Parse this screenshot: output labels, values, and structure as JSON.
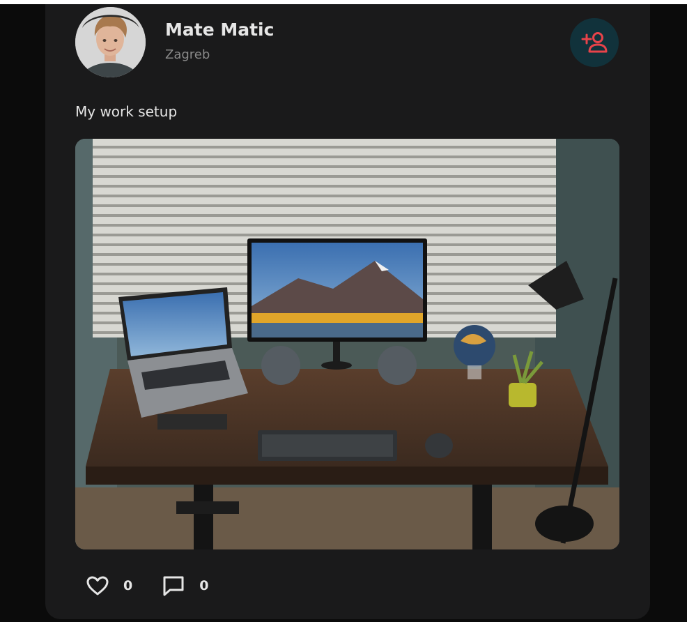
{
  "post": {
    "author": {
      "name": "Mate Matic",
      "location": "Zagreb",
      "avatar_icon": "user-avatar-photo"
    },
    "follow_icon": "add-user-icon",
    "caption": "My work setup",
    "image_icon": "desk-setup-photo",
    "likes": "0",
    "comments": "0"
  },
  "colors": {
    "card_bg": "#1a1a1b",
    "page_bg": "#0b0b0b",
    "accent": "#e8434a",
    "follow_bg": "#11323b",
    "text": "#e6e6e6",
    "muted": "#8a8a8a"
  }
}
